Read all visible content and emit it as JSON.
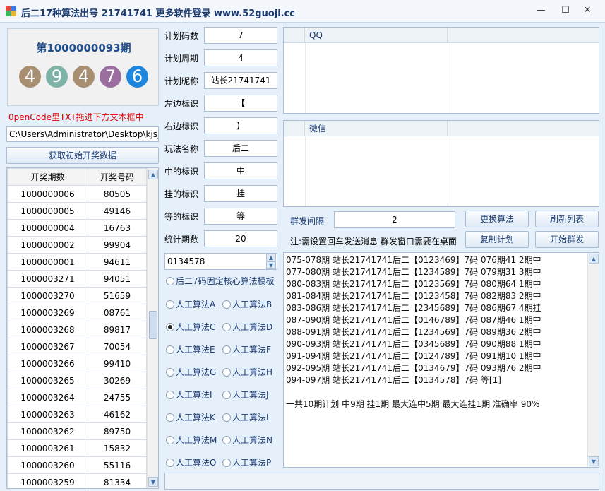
{
  "window": {
    "title": "后二17种算法出号 21741741 更多软件登录 www.52guoji.cc",
    "min_glyph": "—",
    "max_glyph": "☐",
    "close_glyph": "✕"
  },
  "lottery": {
    "period_title": "第1000000093期",
    "balls": [
      "4",
      "9",
      "4",
      "7",
      "6"
    ],
    "ball_colors": [
      "#a88f72",
      "#7fb3a8",
      "#a88f72",
      "#9a6fa0",
      "#1e86dc"
    ]
  },
  "note_red": "0penCode里TXT拖进下方文本框中",
  "file_path": "C:\\Users\\Administrator\\Desktop\\kjsj.",
  "fetch_button": "获取初始开奖数据",
  "table": {
    "headers": [
      "开奖期数",
      "开奖号码"
    ],
    "rows": [
      [
        "1000000006",
        "80505"
      ],
      [
        "1000000005",
        "49146"
      ],
      [
        "1000000004",
        "16763"
      ],
      [
        "1000000002",
        "99904"
      ],
      [
        "1000000001",
        "94611"
      ],
      [
        "1000003271",
        "94051"
      ],
      [
        "1000003270",
        "51659"
      ],
      [
        "1000003269",
        "08761"
      ],
      [
        "1000003268",
        "89817"
      ],
      [
        "1000003267",
        "70054"
      ],
      [
        "1000003266",
        "99410"
      ],
      [
        "1000003265",
        "30269"
      ],
      [
        "1000003264",
        "24755"
      ],
      [
        "1000003263",
        "46162"
      ],
      [
        "1000003262",
        "89750"
      ],
      [
        "1000003261",
        "15832"
      ],
      [
        "1000003260",
        "55116"
      ],
      [
        "1000003259",
        "81334"
      ]
    ]
  },
  "form": {
    "plan_code_count": {
      "label": "计划码数",
      "value": "7"
    },
    "plan_cycle": {
      "label": "计划周期",
      "value": "4"
    },
    "plan_nickname": {
      "label": "计划昵称",
      "value": "站长21741741"
    },
    "left_mark": {
      "label": "左边标识",
      "value": "【"
    },
    "right_mark": {
      "label": "右边标识",
      "value": "】"
    },
    "play_name": {
      "label": "玩法名称",
      "value": "后二"
    },
    "hit_mark": {
      "label": "中的标识",
      "value": "中"
    },
    "miss_mark": {
      "label": "挂的标识",
      "value": "挂"
    },
    "wait_mark": {
      "label": "等的标识",
      "value": "等"
    },
    "stat_count": {
      "label": "统计期数",
      "value": "20"
    }
  },
  "fixed_code": "0134578",
  "radio_template": "后二7码固定核心算法模板",
  "algorithms": [
    {
      "label": "人工算法A",
      "selected": false
    },
    {
      "label": "人工算法B",
      "selected": false
    },
    {
      "label": "人工算法C",
      "selected": true
    },
    {
      "label": "人工算法D",
      "selected": false
    },
    {
      "label": "人工算法E",
      "selected": false
    },
    {
      "label": "人工算法F",
      "selected": false
    },
    {
      "label": "人工算法G",
      "selected": false
    },
    {
      "label": "人工算法H",
      "selected": false
    },
    {
      "label": "人工算法I",
      "selected": false
    },
    {
      "label": "人工算法J",
      "selected": false
    },
    {
      "label": "人工算法K",
      "selected": false
    },
    {
      "label": "人工算法L",
      "selected": false
    },
    {
      "label": "人工算法M",
      "selected": false
    },
    {
      "label": "人工算法N",
      "selected": false
    },
    {
      "label": "人工算法O",
      "selected": false
    },
    {
      "label": "人工算法P",
      "selected": false
    }
  ],
  "qq_grid": {
    "header": "QQ"
  },
  "wechat_grid": {
    "header": "微信"
  },
  "group": {
    "interval_label": "群发间隔",
    "interval_value": "2",
    "change_algo_button": "更换算法",
    "refresh_list_button": "刷新列表",
    "note": "注:需设置回车发送消息 群发窗口需要在桌面",
    "copy_plan_button": "复制计划",
    "start_group_button": "开始群发"
  },
  "log_lines": [
    "075-078期 站长21741741后二【0123469】7码 076期41 2期中",
    "077-080期 站长21741741后二【1234589】7码 079期31 3期中",
    "080-083期 站长21741741后二【0123569】7码 080期64 1期中",
    "081-084期 站长21741741后二【0123458】7码 082期83 2期中",
    "083-086期 站长21741741后二【2345689】7码 086期67 4期挂",
    "087-090期 站长21741741后二【0146789】7码 087期46 1期中",
    "088-091期 站长21741741后二【1234569】7码 089期36 2期中",
    "090-093期 站长21741741后二【0345689】7码 090期88 1期中",
    "091-094期 站长21741741后二【0124789】7码 091期10 1期中",
    "092-095期 站长21741741后二【0134679】7码 093期76 2期中",
    "094-097期 站长21741741后二【0134578】7码 等[1]",
    "",
    "一共10期计划 中9期 挂1期 最大连中5期 最大连挂1期 准确率 90%"
  ]
}
